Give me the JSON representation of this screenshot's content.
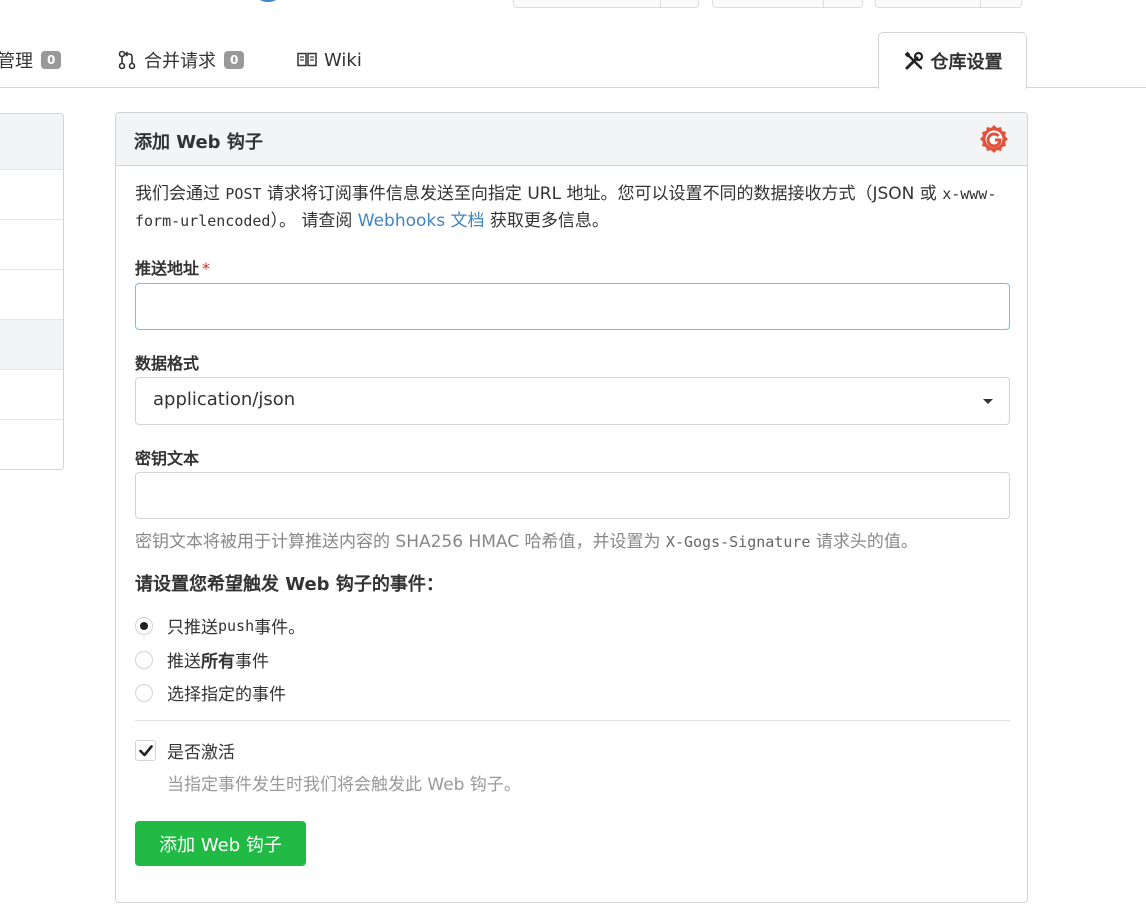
{
  "tabs": {
    "issues_label": "管理",
    "issues_count": "0",
    "pulls_label": "合并请求",
    "pulls_count": "0",
    "wiki_label": "Wiki",
    "settings_label": "仓库设置"
  },
  "panel": {
    "title": "添加 Web 钩子",
    "desc_part1": "我们会通过 ",
    "desc_post": "POST",
    "desc_part2": " 请求将订阅事件信息发送至向指定 URL 地址。您可以设置不同的数据接收方式（JSON 或 ",
    "desc_mime": "x-www-form-urlencoded",
    "desc_part3": "）。 请查阅 ",
    "desc_link": "Webhooks 文档",
    "desc_part4": " 获取更多信息。"
  },
  "form": {
    "payload_url_label": "推送地址",
    "payload_url_value": "",
    "required_mark": "*",
    "content_type_label": "数据格式",
    "content_type_value": "application/json",
    "secret_label": "密钥文本",
    "secret_value": "",
    "secret_help_part1": "密钥文本将被用于计算推送内容的 SHA256 HMAC 哈希值，并设置为 ",
    "secret_help_header": "X-Gogs-Signature",
    "secret_help_part2": " 请求头的值。",
    "events_title": "请设置您希望触发 Web 钩子的事件：",
    "event_push_part1": "只推送 ",
    "event_push_code": "push",
    "event_push_part2": " 事件。",
    "event_all_part1": "推送 ",
    "event_all_bold": "所有",
    "event_all_part2": " 事件",
    "event_choose": "选择指定的事件",
    "active_label": "是否激活",
    "active_help": "当指定事件发生时我们将会触发此 Web 钩子。",
    "submit_label": "添加 Web 钩子"
  },
  "colors": {
    "accent_green": "#21ba45",
    "link_blue": "#4183c4",
    "brand_red": "#e1523d"
  }
}
